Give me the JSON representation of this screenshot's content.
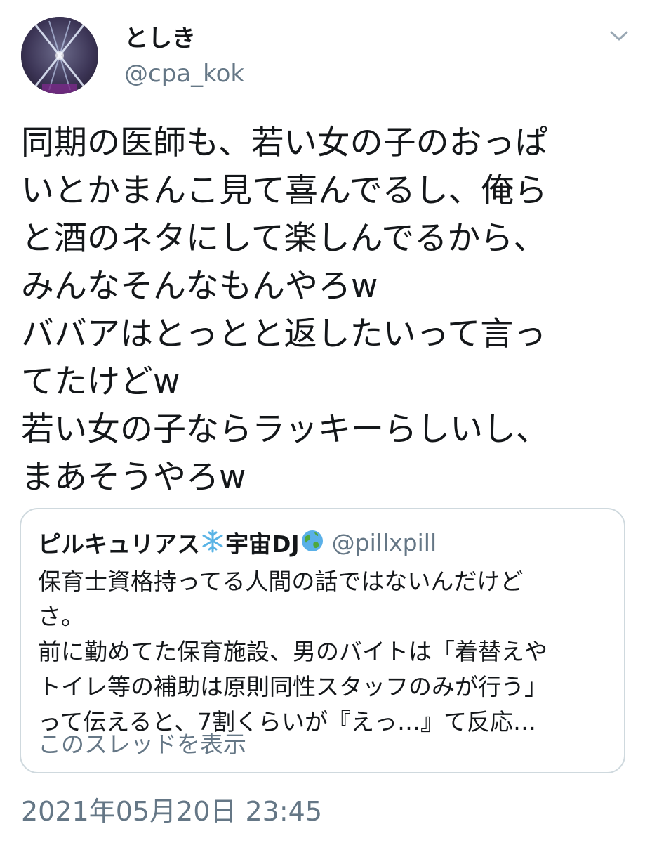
{
  "tweet": {
    "author": {
      "display_name": "としき",
      "handle": "@cpa_kok",
      "avatar_icon": "avatar-stage-lights"
    },
    "more_icon": "chevron-down-icon",
    "text_lines": [
      "同期の医師も、若い女の子のおっぱ",
      "いとかまんこ見て喜んでるし、俺ら",
      "と酒のネタにして楽しんでるから、",
      "みんなそんなもんやろw",
      "ババアはとっとと返したいって言っ",
      "てたけどw",
      "若い女の子ならラッキーらしいし、",
      "まあそうやろw"
    ],
    "quoted_tweet": {
      "display_name": "ピルキュリアス",
      "name_mid": "宇宙DJ",
      "emoji_icons": [
        "snowflake-icon",
        "globe-icon"
      ],
      "handle": "@pillxpill",
      "text_lines": [
        "保育士資格持ってる人間の話ではないんだけど",
        "さ。",
        "前に勤めてた保育施設、男のバイトは「着替えや",
        "トイレ等の補助は原則同性スタッフのみが行う」",
        "って伝えると、7割くらいが『えっ…』て反応…"
      ],
      "show_thread_label": "このスレッドを表示"
    },
    "timestamp": "2021年05月20日 23:45"
  },
  "colors": {
    "text_primary": "#14171a",
    "text_secondary": "#657786",
    "card_border": "#cfd9de"
  }
}
